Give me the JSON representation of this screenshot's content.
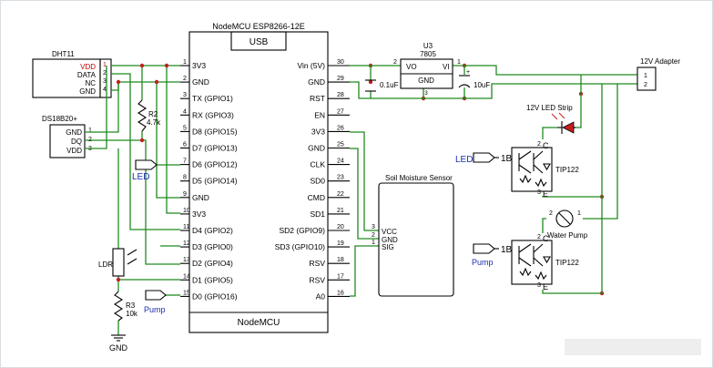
{
  "nodemcu": {
    "title": "NodeMCU ESP8266-12E",
    "usb": "USB",
    "footer": "NodeMCU",
    "left_pins": [
      {
        "num": "1",
        "label": "3V3"
      },
      {
        "num": "2",
        "label": "GND"
      },
      {
        "num": "3",
        "label": "TX (GPIO1)"
      },
      {
        "num": "4",
        "label": "RX (GPIO3)"
      },
      {
        "num": "5",
        "label": "D8 (GPIO15)"
      },
      {
        "num": "6",
        "label": "D7 (GPIO13)"
      },
      {
        "num": "7",
        "label": "D6 (GPIO12)"
      },
      {
        "num": "8",
        "label": "D5 (GPIO14)"
      },
      {
        "num": "9",
        "label": "GND"
      },
      {
        "num": "10",
        "label": "3V3"
      },
      {
        "num": "11",
        "label": "D4 (GPIO2)"
      },
      {
        "num": "12",
        "label": "D3 (GPIO0)"
      },
      {
        "num": "13",
        "label": "D2 (GPIO4)"
      },
      {
        "num": "14",
        "label": "D1 (GPIO5)"
      },
      {
        "num": "15",
        "label": "D0 (GPIO16)"
      }
    ],
    "right_pins": [
      {
        "num": "30",
        "label": "Vin (5V)"
      },
      {
        "num": "29",
        "label": "GND"
      },
      {
        "num": "28",
        "label": "RST"
      },
      {
        "num": "27",
        "label": "EN"
      },
      {
        "num": "26",
        "label": "3V3"
      },
      {
        "num": "25",
        "label": "GND"
      },
      {
        "num": "24",
        "label": "CLK"
      },
      {
        "num": "23",
        "label": "SD0"
      },
      {
        "num": "22",
        "label": "CMD"
      },
      {
        "num": "21",
        "label": "SD1"
      },
      {
        "num": "20",
        "label": "SD2 (GPIO9)"
      },
      {
        "num": "19",
        "label": "SD3 (GPIO10)"
      },
      {
        "num": "18",
        "label": "RSV"
      },
      {
        "num": "17",
        "label": "RSV"
      },
      {
        "num": "16",
        "label": "A0"
      }
    ]
  },
  "dht11": {
    "title": "DHT11",
    "pins": [
      {
        "label": "VDD",
        "num": "1"
      },
      {
        "label": "DATA",
        "num": "2"
      },
      {
        "label": "NC",
        "num": "3"
      },
      {
        "label": "GND",
        "num": "4"
      }
    ]
  },
  "ds18b20": {
    "title": "DS18B20+",
    "pins": [
      {
        "label": "GND",
        "num": "1"
      },
      {
        "label": "DQ",
        "num": "2"
      },
      {
        "label": "VDD",
        "num": "3"
      }
    ]
  },
  "r2": {
    "name": "R2",
    "value": "4.7k"
  },
  "r3": {
    "name": "R3",
    "value": "10k"
  },
  "ldr": "LDR",
  "gnd": "GND",
  "led_port": "LED",
  "pump_port": "Pump",
  "regulator": {
    "ref": "U3",
    "part": "7805",
    "vo": "VO",
    "vi": "VI",
    "gnd": "GND",
    "pin_vo": "2",
    "pin_vi": "1",
    "pin_gnd": "3"
  },
  "caps": {
    "c1": "0.1uF",
    "c2": "10uF"
  },
  "adapter": {
    "title": "12V Adapter",
    "pins": [
      "1",
      "2"
    ]
  },
  "led_strip": "12V LED Strip",
  "water_pump": "Water Pump",
  "soil": {
    "title": "Soil Moisture Sensor",
    "pins": [
      {
        "num": "3",
        "label": "VCC"
      },
      {
        "num": "2",
        "label": "GND"
      },
      {
        "num": "1",
        "label": "SIG"
      }
    ]
  },
  "transistor": {
    "part": "TIP122",
    "b": "1B",
    "c": "C",
    "e": "E",
    "c_num": "2",
    "e_num": "3"
  },
  "wire_color": "#1f8a1f",
  "net_label_color": "#1a2fb0"
}
